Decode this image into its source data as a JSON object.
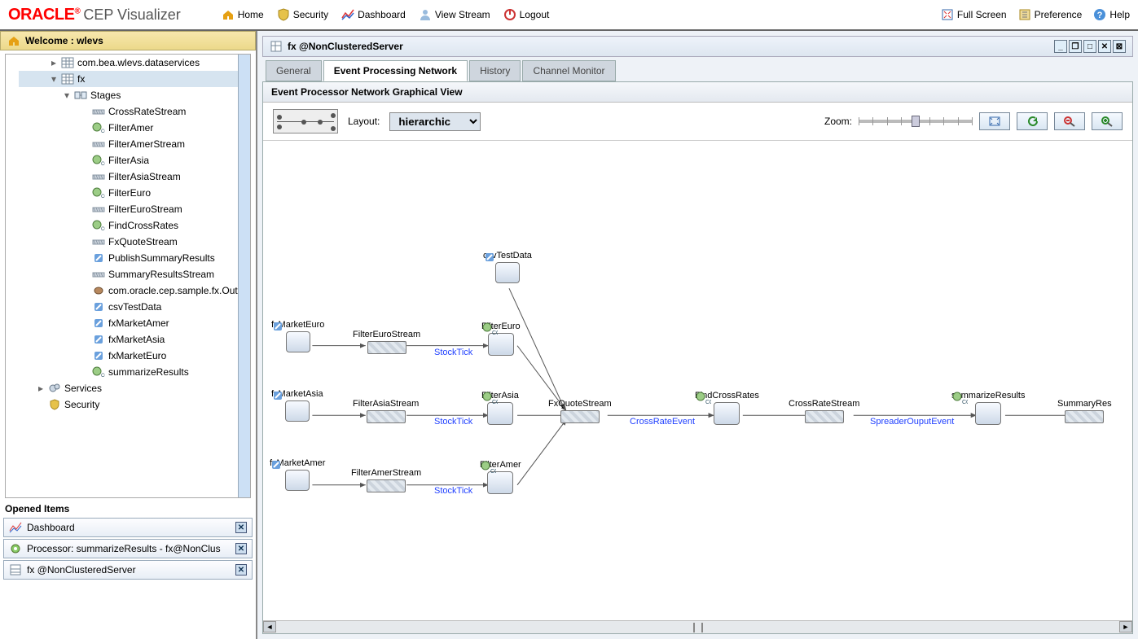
{
  "header": {
    "logo": "ORACLE",
    "logo_sup": "®",
    "product": "CEP Visualizer",
    "nav": {
      "home": "Home",
      "security": "Security",
      "dashboard": "Dashboard",
      "viewstream": "View Stream",
      "logout": "Logout"
    },
    "actions": {
      "fullscreen": "Full Screen",
      "preference": "Preference",
      "help": "Help"
    }
  },
  "welcome": {
    "label": "Welcome : wlevs"
  },
  "tree": {
    "top": "com.bea.wlevs.dataservices",
    "fx": "fx",
    "stages": "Stages",
    "nodes": [
      "CrossRateStream",
      "FilterAmer",
      "FilterAmerStream",
      "FilterAsia",
      "FilterAsiaStream",
      "FilterEuro",
      "FilterEuroStream",
      "FindCrossRates",
      "FxQuoteStream",
      "PublishSummaryResults",
      "SummaryResultsStream",
      "com.oracle.cep.sample.fx.Out",
      "csvTestData",
      "fxMarketAmer",
      "fxMarketAsia",
      "fxMarketEuro",
      "summarizeResults"
    ],
    "services": "Services",
    "security": "Security"
  },
  "opened": {
    "title": "Opened Items",
    "items": [
      "Dashboard",
      "Processor: summarizeResults - fx@NonClus",
      "fx @NonClusteredServer"
    ]
  },
  "main": {
    "title": "fx @NonClusteredServer",
    "tabs": {
      "general": "General",
      "epn": "Event Processing Network",
      "history": "History",
      "chanmon": "Channel Monitor"
    },
    "panel_head": "Event Processor Network Graphical View",
    "layout_label": "Layout:",
    "layout_value": "hierarchic",
    "zoom_label": "Zoom:"
  },
  "graph": {
    "nodes": {
      "csvTestData": "csvTestData",
      "fxMarketEuro": "fxMarketEuro",
      "fxMarketAsia": "fxMarketAsia",
      "fxMarketAmer": "fxMarketAmer",
      "FilterEuroStream": "FilterEuroStream",
      "FilterAsiaStream": "FilterAsiaStream",
      "FilterAmerStream": "FilterAmerStream",
      "FilterEuro": "FilterEuro",
      "FilterAsia": "FilterAsia",
      "FilterAmer": "FilterAmer",
      "FxQuoteStream": "FxQuoteStream",
      "FindCrossRates": "FindCrossRates",
      "CrossRateStream": "CrossRateStream",
      "summarizeResults": "summarizeResults",
      "SummaryRes": "SummaryRes"
    },
    "edges": {
      "StockTick": "StockTick",
      "CrossRateEvent": "CrossRateEvent",
      "SpreaderOuputEvent": "SpreaderOuputEvent"
    }
  }
}
